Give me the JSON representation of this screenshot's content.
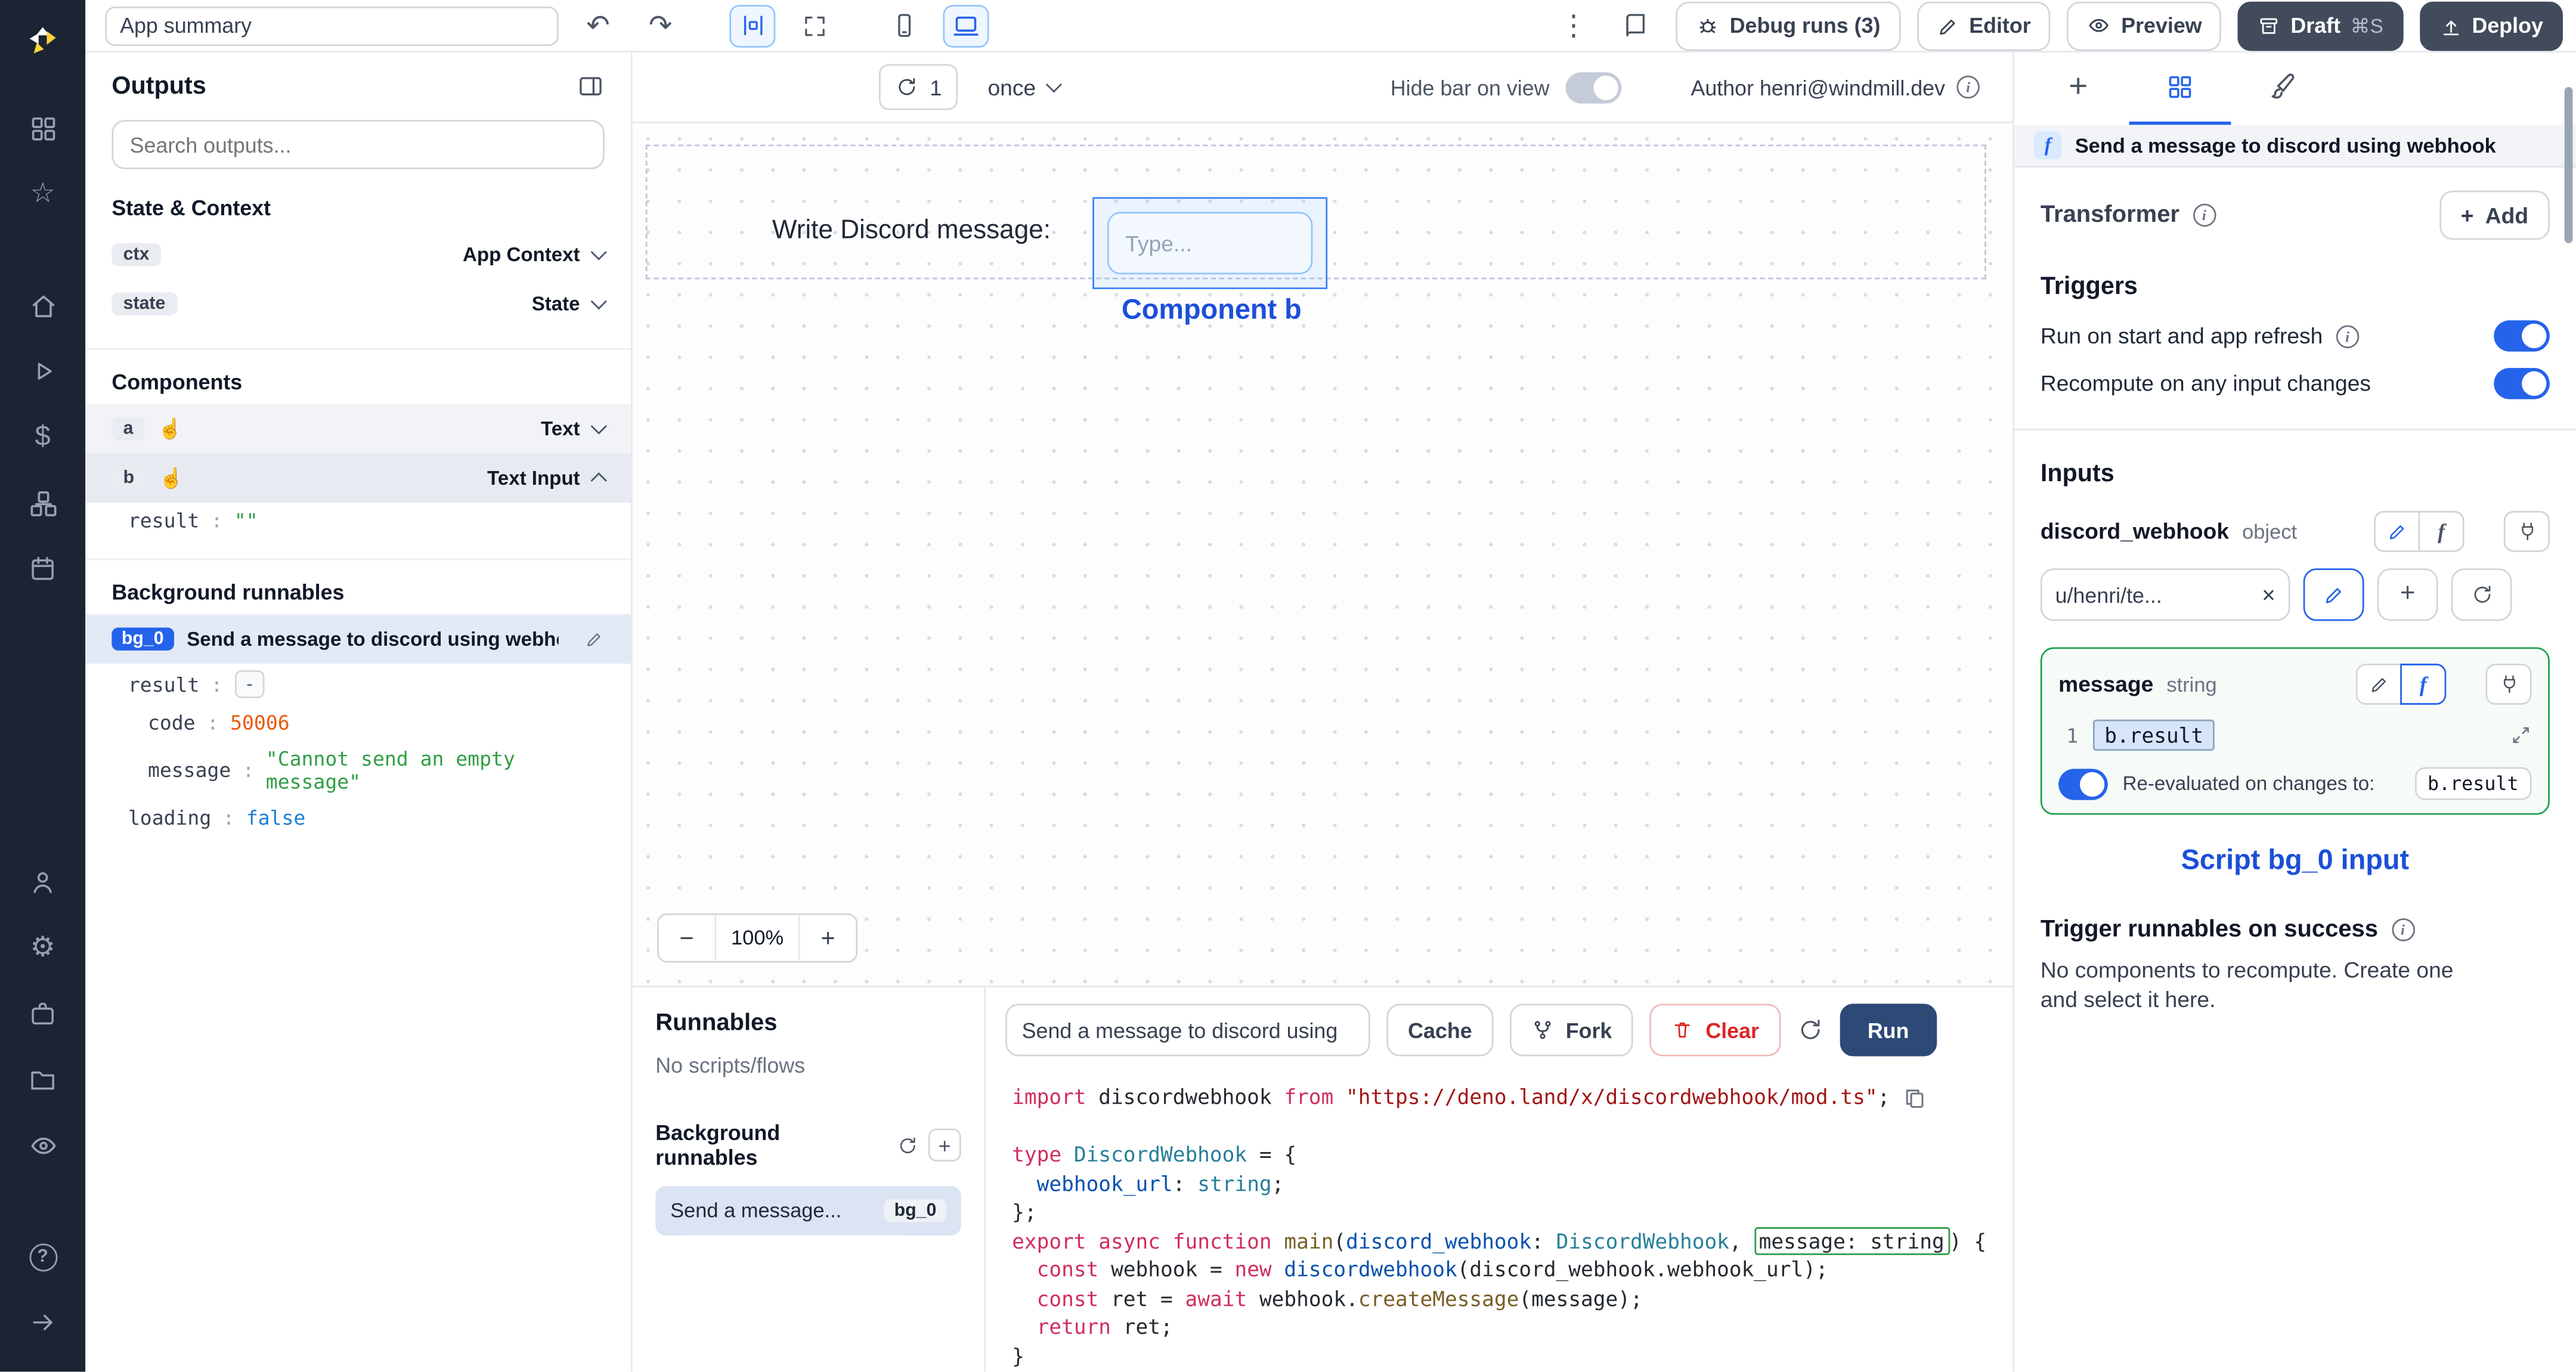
{
  "glyphs": {
    "undo": "↶",
    "redo": "↷",
    "kebab": "⋮",
    "close": "×",
    "minus": "−",
    "plus": "+",
    "gear": "⚙",
    "star": "☆",
    "dollar": "$",
    "question": "?",
    "info": "i",
    "hand": "☝",
    "fn": "f"
  },
  "topbar": {
    "summary_value": "App summary",
    "debug_runs_label": "Debug runs (3)",
    "editor_label": "Editor",
    "preview_label": "Preview",
    "draft_label": "Draft",
    "draft_shortcut": "⌘S",
    "deploy_label": "Deploy"
  },
  "canvas_toolbar": {
    "refresh_count": "1",
    "mode_label": "once",
    "hide_bar_label": "Hide bar on view",
    "author_label": "Author henri@windmill.dev"
  },
  "left_panel": {
    "title": "Outputs",
    "search_placeholder": "Search outputs...",
    "state_context_title": "State & Context",
    "components_title": "Components",
    "background_title": "Background runnables",
    "colon": ":",
    "ctx_badge": "ctx",
    "ctx_label": "App Context",
    "state_badge": "state",
    "state_label": "State",
    "a_badge": "a",
    "a_label": "Text",
    "b_badge": "b",
    "b_label": "Text Input",
    "b_result_key": "result",
    "b_result_value": "\"\"",
    "bg0_badge": "bg_0",
    "bg0_label": "Send a message to discord using webhook",
    "out_result_key": "result",
    "out_result_value": "-",
    "out_code_key": "code",
    "out_code_value": "50006",
    "out_message_key": "message",
    "out_message_value": "\"Cannot send an empty message\"",
    "out_loading_key": "loading",
    "out_loading_value": "false"
  },
  "canvas": {
    "label": "Write Discord message:",
    "input_placeholder": "Type...",
    "annotation": "Component b",
    "zoom_value": "100%"
  },
  "runnables": {
    "title": "Runnables",
    "empty": "No scripts/flows",
    "background_title": "Background runnables",
    "item_label": "Send a message...",
    "item_badge": "bg_0"
  },
  "script_panel": {
    "name": "Send a message to discord using",
    "cache_label": "Cache",
    "fork_label": "Fork",
    "clear_label": "Clear",
    "run_label": "Run",
    "lines": [
      [
        [
          "k",
          "import"
        ],
        [
          "d",
          " discordwebhook "
        ],
        [
          "k",
          "from"
        ],
        [
          "d",
          " "
        ],
        [
          "s",
          "\"https://deno.land/x/discordwebhook/mod.ts\""
        ],
        [
          "d",
          ";"
        ]
      ],
      [],
      [
        [
          "k",
          "type"
        ],
        [
          "d",
          " "
        ],
        [
          "t",
          "DiscordWebhook"
        ],
        [
          "d",
          " = {"
        ]
      ],
      [
        [
          "d",
          "  "
        ],
        [
          "v",
          "webhook_url"
        ],
        [
          "d",
          ": "
        ],
        [
          "t",
          "string"
        ],
        [
          "d",
          ";"
        ]
      ],
      [
        [
          "d",
          "};"
        ]
      ],
      [
        [
          "k",
          "export"
        ],
        [
          "d",
          " "
        ],
        [
          "k",
          "async"
        ],
        [
          "d",
          " "
        ],
        [
          "k",
          "function"
        ],
        [
          "d",
          " "
        ],
        [
          "f",
          "main"
        ],
        [
          "d",
          "("
        ],
        [
          "v",
          "discord_webhook"
        ],
        [
          "d",
          ": "
        ],
        [
          "t",
          "DiscordWebhook"
        ],
        [
          "d",
          ", "
        ],
        [
          "h",
          "message: string"
        ],
        [
          "d",
          ") {"
        ]
      ],
      [
        [
          "d",
          "  "
        ],
        [
          "k",
          "const"
        ],
        [
          "d",
          " webhook = "
        ],
        [
          "k",
          "new"
        ],
        [
          "d",
          " "
        ],
        [
          "v",
          "discordwebhook"
        ],
        [
          "d",
          "(discord_webhook.webhook_url);"
        ]
      ],
      [
        [
          "d",
          "  "
        ],
        [
          "k",
          "const"
        ],
        [
          "d",
          " ret = "
        ],
        [
          "k",
          "await"
        ],
        [
          "d",
          " webhook."
        ],
        [
          "f",
          "createMessage"
        ],
        [
          "d",
          "(message);"
        ]
      ],
      [
        [
          "d",
          "  "
        ],
        [
          "k",
          "return"
        ],
        [
          "d",
          " ret;"
        ]
      ],
      [
        [
          "d",
          "}"
        ]
      ]
    ]
  },
  "right_panel": {
    "header_title": "Send a message to discord using webhook",
    "transformer_label": "Transformer",
    "add_label": "Add",
    "triggers_title": "Triggers",
    "trigger_run_on_start": "Run on start and app refresh",
    "trigger_recompute": "Recompute on any input changes",
    "inputs_title": "Inputs",
    "discord_name": "discord_webhook",
    "discord_type": "object",
    "discord_value": "u/henri/te...",
    "message_name": "message",
    "message_type": "string",
    "message_line_no": "1",
    "message_expr": "b.result",
    "reeval_label": "Re-evaluated on changes to:",
    "reeval_value": "b.result",
    "annotation": "Script bg_0 input",
    "success_title": "Trigger runnables on success",
    "success_note": "No components to recompute. Create one and select it here."
  }
}
